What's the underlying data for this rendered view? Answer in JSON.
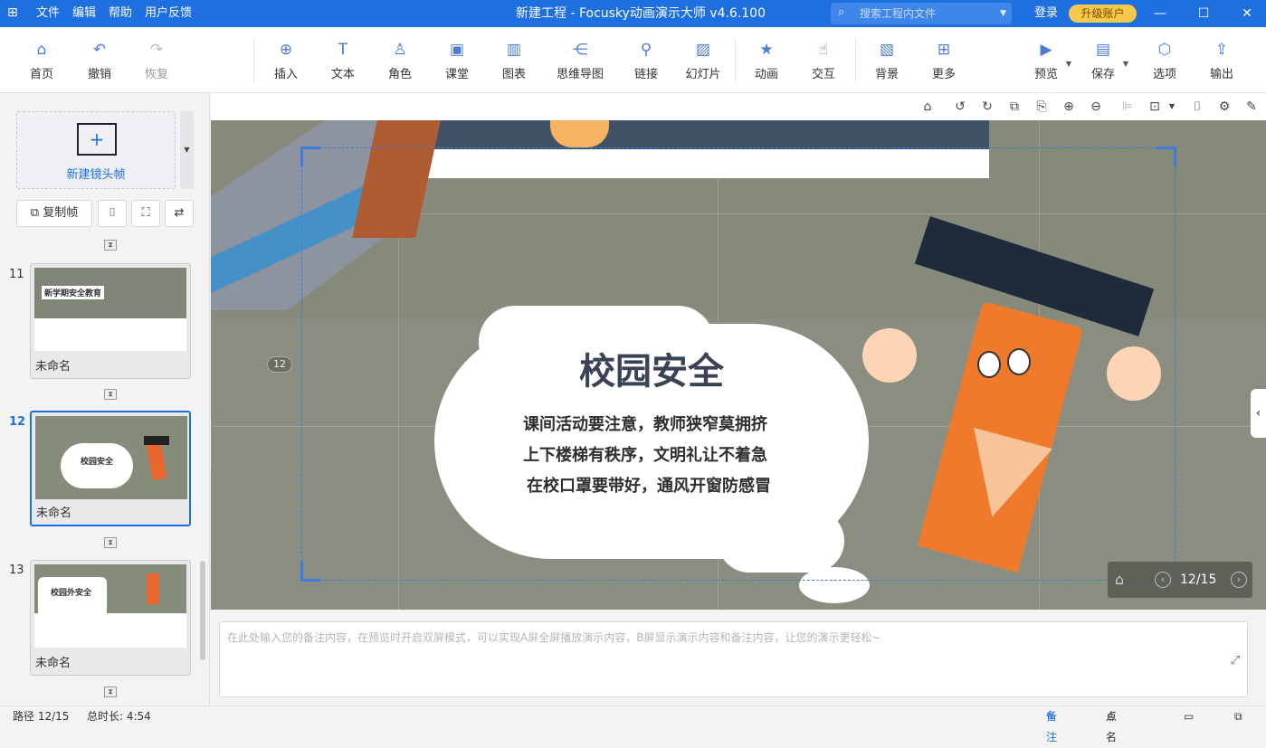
{
  "titlebar": {
    "menu": [
      "文件",
      "编辑",
      "帮助",
      "用户反馈"
    ],
    "title": "新建工程 - Focusky动画演示大师  v4.6.100",
    "search_placeholder": "搜索工程内文件",
    "login": "登录",
    "upgrade": "升级账户"
  },
  "toolbar": {
    "home": "首页",
    "undo": "撤销",
    "redo": "恢复",
    "insert": "插入",
    "text": "文本",
    "role": "角色",
    "classroom": "课堂",
    "chart": "图表",
    "mindmap": "思维导图",
    "link": "链接",
    "slideshow": "幻灯片",
    "animation": "动画",
    "interact": "交互",
    "background": "背景",
    "more": "更多",
    "preview": "预览",
    "save": "保存",
    "options": "选项",
    "export": "输出"
  },
  "left": {
    "new_frame": "新建镜头帧",
    "copy_frame": "复制帧",
    "slides": [
      {
        "num": "11",
        "name": "未命名",
        "caption": "新学期安全教育"
      },
      {
        "num": "12",
        "name": "未命名",
        "caption": "校园安全"
      },
      {
        "num": "13",
        "name": "未命名",
        "caption": "校园外安全"
      }
    ]
  },
  "canvas": {
    "title": "校园安全",
    "lines": [
      "课间活动要注意，教师狭窄莫拥挤",
      "上下楼梯有秩序，文明礼让不着急",
      "在校口罩要带好，通风开窗防感冒"
    ],
    "frame_badge": "12",
    "pager": "12/15"
  },
  "notes": {
    "placeholder": "在此处输入您的备注内容，在预览时开启双屏模式，可以实现A屏全屏播放演示内容，B屏显示演示内容和备注内容，让您的演示更轻松~"
  },
  "status": {
    "path": "路径 12/15",
    "duration": "总时长: 4:54",
    "notes": "备注",
    "rollcall": "点名"
  },
  "colors": {
    "accent": "#1e6fe0",
    "canvas_bg": "#8a8e80",
    "upgrade_bg": "#f7c94a"
  }
}
